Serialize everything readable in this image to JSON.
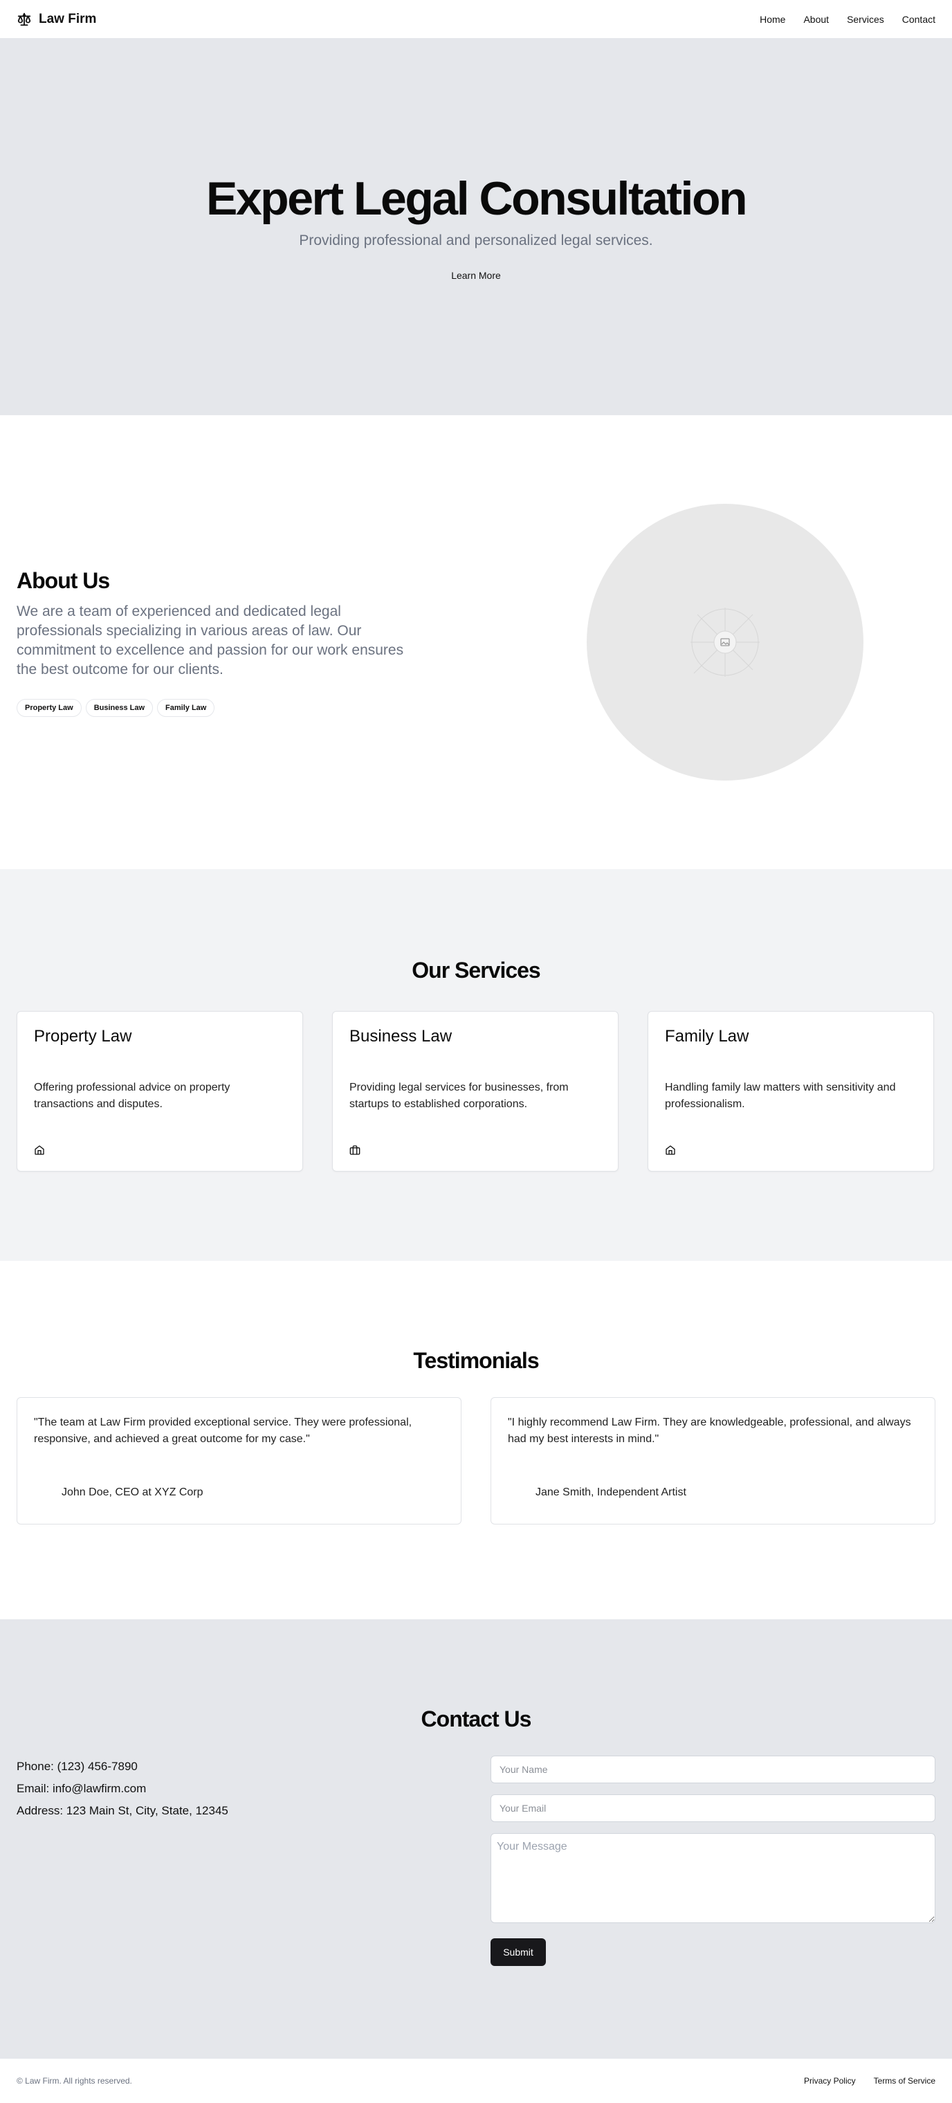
{
  "header": {
    "brand": "Law Firm",
    "brand_icon": "scale-icon",
    "nav": [
      "Home",
      "About",
      "Services",
      "Contact"
    ]
  },
  "hero": {
    "title": "Expert Legal Consultation",
    "subtitle": "Providing professional and personalized legal services.",
    "cta": "Learn More"
  },
  "about": {
    "title": "About Us",
    "text": "We are a team of experienced and dedicated legal professionals specializing in various areas of law. Our commitment to excellence and passion for our work ensures the best outcome for our clients.",
    "tags": [
      "Property Law",
      "Business Law",
      "Family Law"
    ],
    "image_icon": "image-placeholder-icon"
  },
  "services": {
    "title": "Our Services",
    "items": [
      {
        "title": "Property Law",
        "description": "Offering professional advice on property transactions and disputes.",
        "icon": "home-icon"
      },
      {
        "title": "Business Law",
        "description": "Providing legal services for businesses, from startups to established corporations.",
        "icon": "briefcase-icon"
      },
      {
        "title": "Family Law",
        "description": "Handling family law matters with sensitivity and professionalism.",
        "icon": "home-icon"
      }
    ]
  },
  "testimonials": {
    "title": "Testimonials",
    "items": [
      {
        "quote": "\"The team at Law Firm provided exceptional service. They were professional, responsive, and achieved a great outcome for my case.\"",
        "author": "John Doe, CEO at XYZ Corp"
      },
      {
        "quote": "\"I highly recommend Law Firm. They are knowledgeable, professional, and always had my best interests in mind.\"",
        "author": "Jane Smith, Independent Artist"
      }
    ]
  },
  "contact": {
    "title": "Contact Us",
    "phone": "Phone: (123) 456-7890",
    "email": "Email: info@lawfirm.com",
    "address": "Address: 123 Main St, City, State, 12345",
    "name_placeholder": "Your Name",
    "email_placeholder": "Your Email",
    "message_placeholder": "Your Message",
    "submit": "Submit"
  },
  "footer": {
    "copyright": "© Law Firm. All rights reserved.",
    "links": [
      "Privacy Policy",
      "Terms of Service"
    ]
  }
}
